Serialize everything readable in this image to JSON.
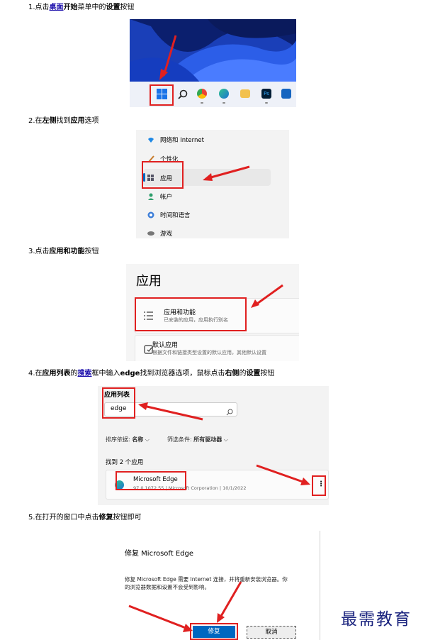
{
  "step1": {
    "prefix": "1.点击",
    "link": "桌面",
    "bold1": "开始",
    "mid": "菜单中的",
    "bold2": "设置",
    "suffix": "按钮"
  },
  "step2": {
    "prefix": "2.在",
    "bold1": "左侧",
    "mid": "找到",
    "bold2": "应用",
    "suffix": "选项"
  },
  "step3": {
    "prefix": "3.点击",
    "bold1": "应用和功能",
    "suffix": "按钮"
  },
  "step4": {
    "prefix": "4.在",
    "bold1": "应用列表",
    "mid1": "的",
    "link": "搜索",
    "mid2": "框中输入",
    "bold2": "edge",
    "mid3": "找到浏览器选项，鼠标点击",
    "bold3": "右侧",
    "mid4": "的",
    "bold4": "设置",
    "suffix": "按钮"
  },
  "step5": {
    "prefix": "5.在打开的窗口中点击",
    "bold1": "修复",
    "suffix": "按钮即可"
  },
  "settings_menu": {
    "items": [
      "网络和 Internet",
      "个性化",
      "应用",
      "帐户",
      "时间和语言",
      "游戏"
    ]
  },
  "apps_page": {
    "title": "应用",
    "apps_features_title": "应用和功能",
    "apps_features_desc": "已安装的应用，应用执行别名",
    "default_apps_title": "默认应用",
    "default_apps_desc": "根据文件和链接类型设置的默认应用，其他默认设置"
  },
  "app_list": {
    "header": "应用列表",
    "search_value": "edge",
    "sort_label": "排序依据:",
    "sort_value": "名称",
    "filter_label": "筛选条件:",
    "filter_value": "所有驱动器",
    "found": "找到 2 个应用",
    "app_name": "Microsoft Edge",
    "app_version": "97.0.1072.55",
    "app_publisher": "Microsoft Corporation",
    "app_date": "10/1/2022",
    "more_icon": "more-vertical-icon"
  },
  "repair_dialog": {
    "title": "修复 Microsoft Edge",
    "body_line1": "修复 Microsoft Edge 需要 Internet 连接，并将重新安装浏览器。你",
    "body_line2": "的浏览器数据和设置不会受到影响。",
    "repair_label": "修复",
    "cancel_label": "取消"
  },
  "watermark": "最需教育",
  "colors": {
    "highlight": "#e02020",
    "accent": "#0067c0",
    "link": "#1a0dab"
  }
}
